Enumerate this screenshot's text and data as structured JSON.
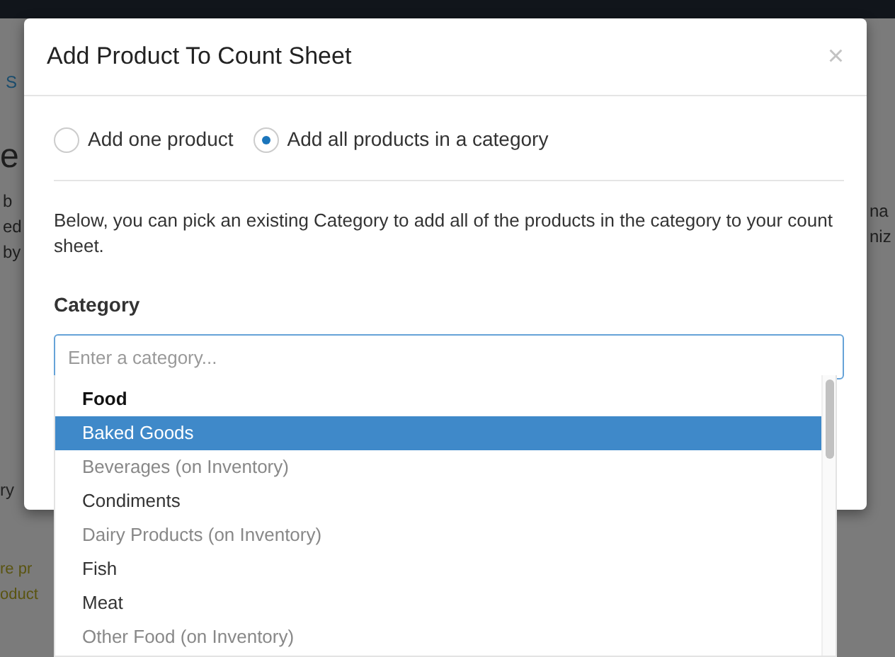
{
  "background_page": {
    "left_fragments": [
      {
        "text": "S",
        "kind": "link"
      },
      {
        "text": "e",
        "kind": "heading"
      },
      {
        "text": "b",
        "kind": "text"
      },
      {
        "text": "ed",
        "kind": "text"
      },
      {
        "text": "by",
        "kind": "text"
      },
      {
        "text": "ry",
        "kind": "cell"
      },
      {
        "text": "re pr",
        "kind": "warning"
      },
      {
        "text": "oduct",
        "kind": "warning"
      }
    ],
    "right_fragments": [
      {
        "text": "na",
        "kind": "text"
      },
      {
        "text": "niz",
        "kind": "text"
      }
    ]
  },
  "modal": {
    "title": "Add Product To Count Sheet",
    "close": "×",
    "modes": [
      {
        "label": "Add one product",
        "selected": false
      },
      {
        "label": "Add all products in a category",
        "selected": true
      }
    ],
    "description": "Below, you can pick an existing Category to add all of the products in the category to your count sheet.",
    "category_label": "Category",
    "category_field": {
      "placeholder": "Enter a category..."
    },
    "options": [
      {
        "label": "Food",
        "kind": "header",
        "selected": false,
        "disabled": false
      },
      {
        "label": "Baked Goods",
        "kind": "option",
        "selected": true,
        "disabled": false
      },
      {
        "label": "Beverages (on Inventory)",
        "kind": "option",
        "selected": false,
        "disabled": true
      },
      {
        "label": "Condiments",
        "kind": "option",
        "selected": false,
        "disabled": false
      },
      {
        "label": "Dairy Products (on Inventory)",
        "kind": "option",
        "selected": false,
        "disabled": true
      },
      {
        "label": "Fish",
        "kind": "option",
        "selected": false,
        "disabled": false
      },
      {
        "label": "Meat",
        "kind": "option",
        "selected": false,
        "disabled": false
      },
      {
        "label": "Other Food (on Inventory)",
        "kind": "option",
        "selected": false,
        "disabled": true
      }
    ]
  }
}
